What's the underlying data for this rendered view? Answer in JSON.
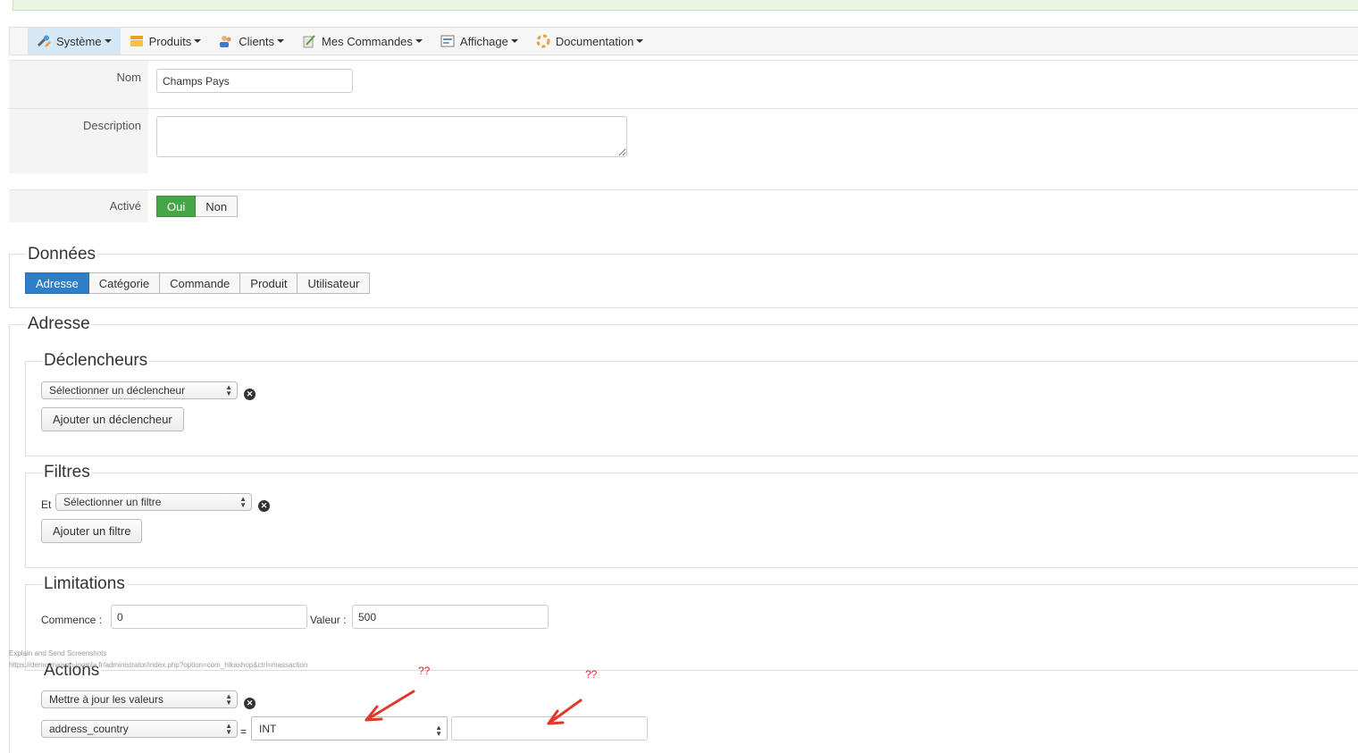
{
  "menu": {
    "items": [
      {
        "label": "Système",
        "icon": "wrench-icon",
        "active": true
      },
      {
        "label": "Produits",
        "icon": "folder-icon"
      },
      {
        "label": "Clients",
        "icon": "users-icon"
      },
      {
        "label": "Mes Commandes",
        "icon": "orders-icon"
      },
      {
        "label": "Affichage",
        "icon": "display-icon"
      },
      {
        "label": "Documentation",
        "icon": "help-icon"
      }
    ]
  },
  "form": {
    "name_label": "Nom",
    "name_value": "Champs Pays",
    "description_label": "Description",
    "description_value": "",
    "active_label": "Activé",
    "active_yes": "Oui",
    "active_no": "Non"
  },
  "donnees": {
    "legend": "Données",
    "tabs": [
      "Adresse",
      "Catégorie",
      "Commande",
      "Produit",
      "Utilisateur"
    ],
    "active_tab": "Adresse"
  },
  "adresse": {
    "legend": "Adresse",
    "declencheurs": {
      "legend": "Déclencheurs",
      "select_value": "Sélectionner un déclencheur",
      "add_button": "Ajouter un déclencheur"
    },
    "filtres": {
      "legend": "Filtres",
      "prefix": "Et",
      "select_value": "Sélectionner un filtre",
      "add_button": "Ajouter un filtre"
    },
    "limitations": {
      "legend": "Limitations",
      "start_label": "Commence :",
      "start_value": "0",
      "value_label": "Valeur :",
      "value_value": "500"
    },
    "actions": {
      "legend": "Actions",
      "select_value": "Mettre à jour les valeurs",
      "field_select": "address_country",
      "equals": "=",
      "type_select": "INT",
      "value_input": ""
    }
  },
  "overlay": {
    "line1": "Explain and Send Screenshots",
    "line2": "https://demo.maison-joomla.fr/administrator/index.php?option=com_hikashop&ctrl=massaction"
  },
  "annotations": {
    "q1": "??",
    "q2": "??",
    "arrow_color": "#e0392b"
  }
}
